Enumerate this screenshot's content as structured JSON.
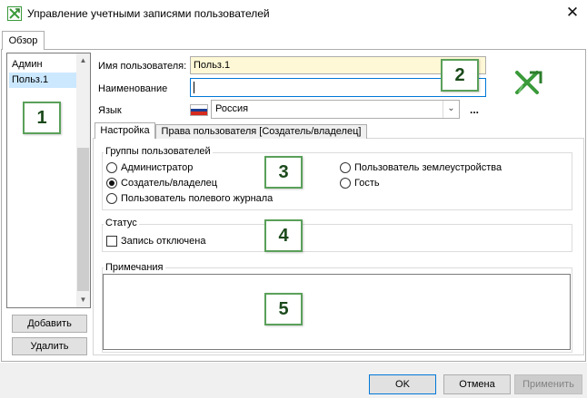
{
  "window": {
    "title": "Управление учетными записями пользователей",
    "close_glyph": "✕",
    "app_icon": "app-logo-icon"
  },
  "outer_tab": {
    "label": "Обзор"
  },
  "user_list": {
    "items": [
      "Админ",
      "Польз.1"
    ],
    "selected_index": 1
  },
  "buttons": {
    "add": "Добавить",
    "delete": "Удалить"
  },
  "fields": {
    "username_label": "Имя пользователя:",
    "username_value": "Польз.1",
    "name_label": "Наименование",
    "name_value": "",
    "language_label": "Язык",
    "language_value": "Россия",
    "more_label": "..."
  },
  "inner_tabs": [
    "Настройка",
    "Права пользователя [Создатель/владелец]"
  ],
  "groups": {
    "title": "Группы пользователей",
    "options": [
      {
        "label": "Администратор",
        "selected": false
      },
      {
        "label": "Создатель/владелец",
        "selected": true
      },
      {
        "label": "Пользователь полевого журнала",
        "selected": false
      },
      {
        "label": "Пользователь землеустройства",
        "selected": false
      },
      {
        "label": "Гость",
        "selected": false
      }
    ]
  },
  "status": {
    "title": "Статус",
    "disabled_label": "Запись отключена",
    "disabled_checked": false
  },
  "notes": {
    "title": "Примечания",
    "value": ""
  },
  "callouts": [
    "1",
    "2",
    "3",
    "4",
    "5"
  ],
  "footer": {
    "ok": "OK",
    "cancel": "Отмена",
    "apply": "Применить"
  },
  "colors": {
    "accent": "#0078d7",
    "selection": "#cce8ff",
    "username_bg": "#fff8d6",
    "callout_border": "#5aa05a",
    "logo_green": "#3a9a3a",
    "flag": [
      "#ffffff",
      "#1c3f94",
      "#d52b1e"
    ]
  },
  "icons": {
    "close": "close-icon",
    "dropdown": "chevron-down-icon",
    "scroll_up": "scroll-up-icon",
    "scroll_down": "scroll-down-icon",
    "flag": "russia-flag-icon"
  }
}
